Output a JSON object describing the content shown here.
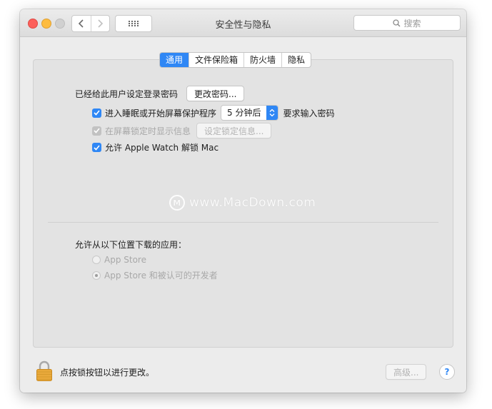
{
  "window": {
    "title": "安全性与隐私",
    "search_placeholder": "搜索"
  },
  "tabs": [
    {
      "label": "通用",
      "active": true
    },
    {
      "label": "文件保险箱",
      "active": false
    },
    {
      "label": "防火墙",
      "active": false
    },
    {
      "label": "隐私",
      "active": false
    }
  ],
  "general": {
    "password_set_label": "已经给此用户设定登录密码",
    "change_password_button": "更改密码...",
    "require_password": {
      "label": "进入睡眠或开始屏幕保护程序",
      "checked": true,
      "delay_value": "5 分钟后",
      "suffix": "要求输入密码"
    },
    "show_message": {
      "label": "在屏幕锁定时显示信息",
      "checked": true,
      "enabled": false,
      "button": "设定锁定信息..."
    },
    "apple_watch": {
      "label": "允许 Apple Watch 解锁 Mac",
      "checked": true
    }
  },
  "watermark": {
    "text": "www.MacDown.com",
    "logo_letter": "M"
  },
  "downloads": {
    "heading": "允许从以下位置下载的应用：",
    "options": [
      {
        "label": "App Store",
        "selected": false,
        "enabled": false
      },
      {
        "label": "App Store 和被认可的开发者",
        "selected": true,
        "enabled": false
      }
    ]
  },
  "footer": {
    "lock_text": "点按锁按钮以进行更改。",
    "advanced_button": "高级...",
    "help_label": "?"
  },
  "colors": {
    "accent": "#2f87f5",
    "window_bg": "#ececec",
    "panel_bg": "#e3e3e3"
  }
}
